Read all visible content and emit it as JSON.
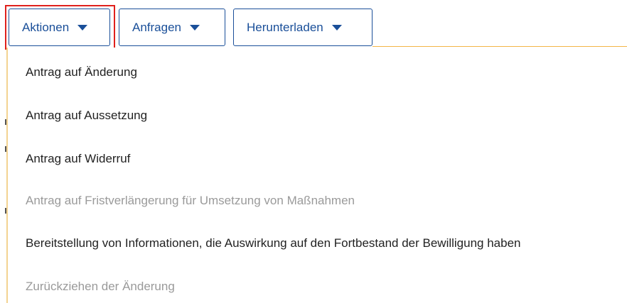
{
  "toolbar": {
    "buttons": [
      {
        "label": "Aktionen",
        "icon": "caret-down-icon",
        "active": true
      },
      {
        "label": "Anfragen",
        "icon": "caret-down-icon",
        "active": false
      },
      {
        "label": "Herunterladen",
        "icon": "caret-down-icon",
        "active": false
      }
    ]
  },
  "menu": {
    "items": [
      {
        "label": "Antrag auf Änderung",
        "enabled": true
      },
      {
        "label": "Antrag auf Aussetzung",
        "enabled": true
      },
      {
        "label": "Antrag auf Widerruf",
        "enabled": true
      },
      {
        "label": "Antrag auf Fristverlängerung für Umsetzung von Maßnahmen",
        "enabled": false
      },
      {
        "label": "Bereitstellung von Informationen, die Auswirkung auf den Fortbestand der Bewilligung haben",
        "enabled": true
      },
      {
        "label": "Zurückziehen der Änderung",
        "enabled": false
      }
    ]
  },
  "colors": {
    "primary": "#1a4f99",
    "highlight_border": "#e0201c",
    "accent_rule": "#f3b547",
    "disabled_text": "#9a9a9a"
  }
}
